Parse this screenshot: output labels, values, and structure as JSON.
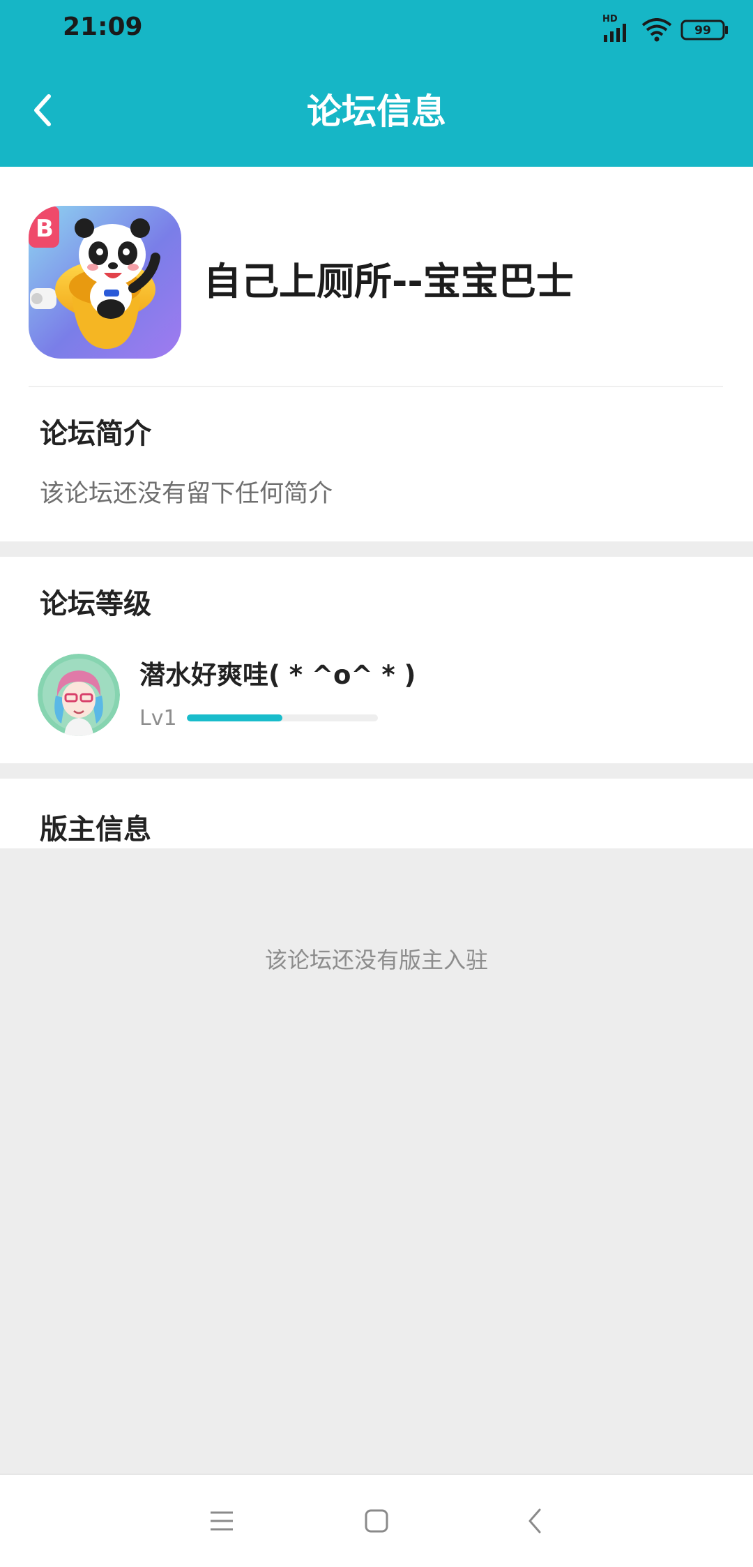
{
  "status_bar": {
    "time": "21:09",
    "network_label": "HD",
    "battery_level": "99"
  },
  "header": {
    "title": "论坛信息",
    "back_icon": "chevron-left-icon"
  },
  "forum": {
    "name": "自己上厕所--宝宝巴士",
    "icon": "panda-toilet-app-icon"
  },
  "intro": {
    "title": "论坛简介",
    "text": "该论坛还没有留下任何简介"
  },
  "level": {
    "title": "论坛等级",
    "username": "潜水好爽哇(  * ^o^ *  )",
    "level_label": "Lv1",
    "progress_percent": 50,
    "accent_color": "#19bccb"
  },
  "moderator": {
    "title": "版主信息",
    "empty_text": "该论坛还没有版主入驻"
  },
  "nav_bar": {
    "menu_icon": "menu-icon",
    "home_icon": "home-icon",
    "back_icon": "back-icon"
  },
  "colors": {
    "brand": "#16b6c6",
    "background": "#ededed"
  }
}
